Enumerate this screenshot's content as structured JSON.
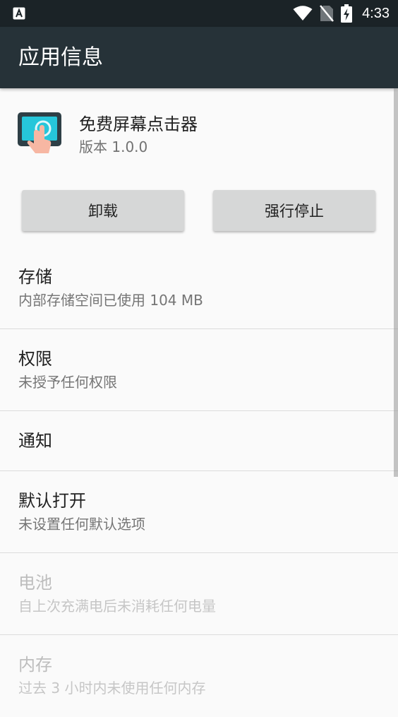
{
  "status_bar": {
    "time": "4:33",
    "left_icon": "a-icon",
    "icons": [
      "wifi-icon",
      "no-sim-icon",
      "battery-charging-icon"
    ]
  },
  "app_bar": {
    "title": "应用信息"
  },
  "app": {
    "name": "免费屏幕点击器",
    "version": "版本 1.0.0",
    "icon": "app-touch-icon",
    "icon_colors": {
      "frame": "#2e3f46",
      "screen": "#26c6da",
      "hand": "#f7b7a3"
    }
  },
  "buttons": {
    "uninstall": "卸载",
    "force_stop": "强行停止"
  },
  "items": [
    {
      "title": "存储",
      "subtitle": "内部存储空间已使用 104 MB",
      "enabled": true
    },
    {
      "title": "权限",
      "subtitle": "未授予任何权限",
      "enabled": true
    },
    {
      "title": "通知",
      "enabled": true
    },
    {
      "title": "默认打开",
      "subtitle": "未设置任何默认选项",
      "enabled": true
    },
    {
      "title": "电池",
      "subtitle": "自上次充满电后未消耗任何电量",
      "enabled": false
    },
    {
      "title": "内存",
      "subtitle": "过去 3 小时内未使用任何内存",
      "enabled": false
    }
  ],
  "colors": {
    "status_bar": "#1b2327",
    "app_bar": "#263238",
    "background": "#fafafa",
    "button": "#d6d7d7"
  }
}
